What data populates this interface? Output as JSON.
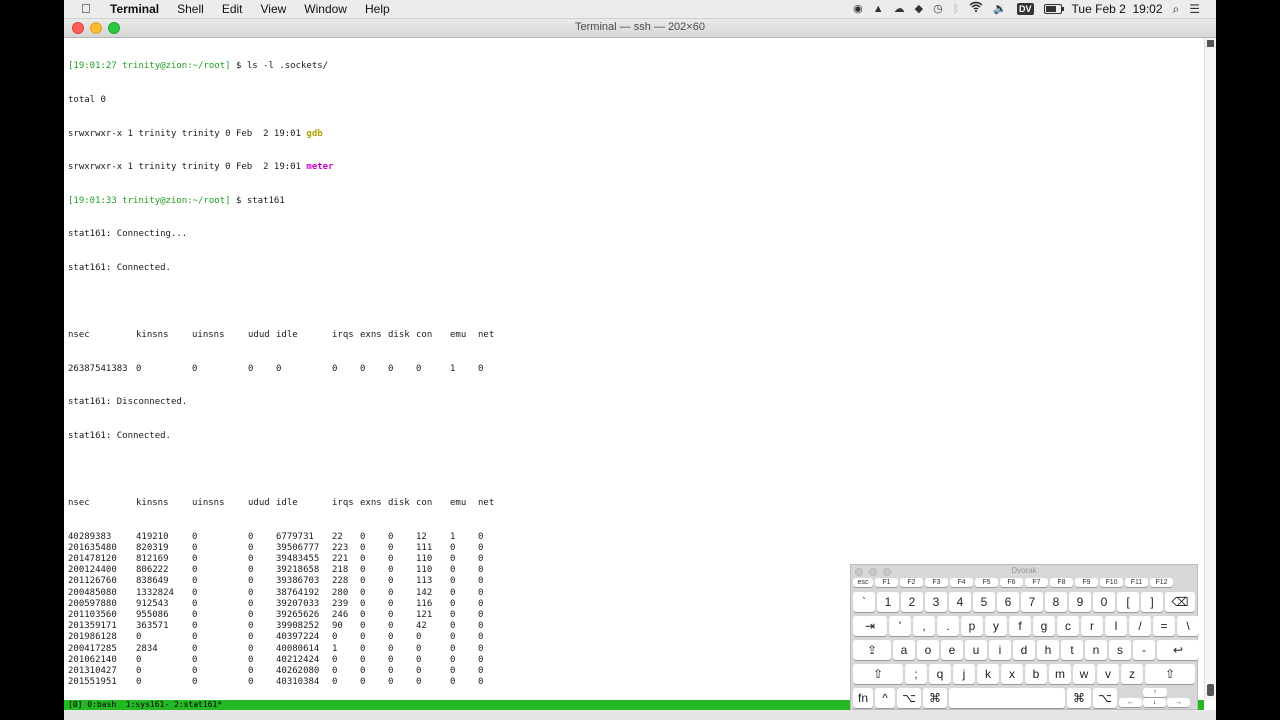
{
  "menubar": {
    "app_name": "Terminal",
    "items": [
      "Shell",
      "Edit",
      "View",
      "Window",
      "Help"
    ],
    "status_icons": [
      "record-icon",
      "drive-icon",
      "cloud-icon",
      "dropbox-icon",
      "time-machine-icon",
      "bluetooth-icon",
      "wifi-icon",
      "volume-icon"
    ],
    "input_source": "DV",
    "clock": "Tue Feb 2  19:02"
  },
  "window": {
    "title": "Terminal — ssh — 202×60"
  },
  "terminal": {
    "line1": {
      "prompt": "[19:01:27 trinity@zion:~/root]",
      "cmd": " $ ls -l .sockets/"
    },
    "line2": "total 0",
    "line3": {
      "text": "srwxrwxr-x 1 trinity trinity 0 Feb  2 19:01 ",
      "name": "gdb"
    },
    "line4": {
      "text": "srwxrwxr-x 1 trinity trinity 0 Feb  2 19:01 ",
      "name": "meter"
    },
    "line5": {
      "prompt": "[19:01:33 trinity@zion:~/root]",
      "cmd": " $ stat161"
    },
    "line6": "stat161: Connecting...",
    "line7": "stat161: Connected.",
    "headers": [
      "nsec",
      "kinsns",
      "uinsns",
      "udud",
      "idle",
      "irqs",
      "exns",
      "disk",
      "con",
      "emu",
      "net"
    ],
    "table1": [
      [
        "26387541383",
        "0",
        "0",
        "0",
        "0",
        "0",
        "0",
        "0",
        "0",
        "1",
        "0"
      ]
    ],
    "line_disc": "stat161: Disconnected.",
    "line_conn": "stat161: Connected.",
    "table2": [
      [
        "40289383",
        "419210",
        "0",
        "0",
        "6779731",
        "22",
        "0",
        "0",
        "12",
        "1",
        "0"
      ],
      [
        "201635480",
        "820319",
        "0",
        "0",
        "39506777",
        "223",
        "0",
        "0",
        "111",
        "0",
        "0"
      ],
      [
        "201478120",
        "812169",
        "0",
        "0",
        "39483455",
        "221",
        "0",
        "0",
        "110",
        "0",
        "0"
      ],
      [
        "200124400",
        "806222",
        "0",
        "0",
        "39218658",
        "218",
        "0",
        "0",
        "110",
        "0",
        "0"
      ],
      [
        "201126760",
        "838649",
        "0",
        "0",
        "39386703",
        "228",
        "0",
        "0",
        "113",
        "0",
        "0"
      ],
      [
        "200485080",
        "1332824",
        "0",
        "0",
        "38764192",
        "280",
        "0",
        "0",
        "142",
        "0",
        "0"
      ],
      [
        "200597880",
        "912543",
        "0",
        "0",
        "39207033",
        "239",
        "0",
        "0",
        "116",
        "0",
        "0"
      ],
      [
        "201103560",
        "955086",
        "0",
        "0",
        "39265626",
        "246",
        "0",
        "0",
        "121",
        "0",
        "0"
      ],
      [
        "201359171",
        "363571",
        "0",
        "0",
        "39908252",
        "90",
        "0",
        "0",
        "42",
        "0",
        "0"
      ],
      [
        "201986128",
        "0",
        "0",
        "0",
        "40397224",
        "0",
        "0",
        "0",
        "0",
        "0",
        "0"
      ],
      [
        "200417285",
        "2834",
        "0",
        "0",
        "40080614",
        "1",
        "0",
        "0",
        "0",
        "0",
        "0"
      ],
      [
        "201062140",
        "0",
        "0",
        "0",
        "40212424",
        "0",
        "0",
        "0",
        "0",
        "0",
        "0"
      ],
      [
        "201310427",
        "0",
        "0",
        "0",
        "40262080",
        "0",
        "0",
        "0",
        "0",
        "0",
        "0"
      ],
      [
        "201551951",
        "0",
        "0",
        "0",
        "40310384",
        "0",
        "0",
        "0",
        "0",
        "0",
        "0"
      ]
    ]
  },
  "tmux_status": "[0] 0:bash  1:sys161- 2:stat161*",
  "keyboard": {
    "title": "Dvorak",
    "fn_row": [
      "esc",
      "F1",
      "F2",
      "F3",
      "F4",
      "F5",
      "F6",
      "F7",
      "F8",
      "F9",
      "F10",
      "F11",
      "F12"
    ],
    "row1": [
      "`",
      "1",
      "2",
      "3",
      "4",
      "5",
      "6",
      "7",
      "8",
      "9",
      "0",
      "[",
      "]",
      "⌫"
    ],
    "row2": [
      "⇥",
      "'",
      ",",
      ".",
      "p",
      "y",
      "f",
      "g",
      "c",
      "r",
      "l",
      "/",
      "=",
      "\\"
    ],
    "row3": [
      "⇪",
      "a",
      "o",
      "e",
      "u",
      "i",
      "d",
      "h",
      "t",
      "n",
      "s",
      "-",
      "↩"
    ],
    "row4": [
      "⇧",
      ";",
      "q",
      "j",
      "k",
      "x",
      "b",
      "m",
      "w",
      "v",
      "z",
      "⇧"
    ],
    "row5": [
      "fn",
      "^",
      "⌥",
      "⌘",
      "",
      "⌘",
      "⌥"
    ],
    "arrows": [
      "↑",
      "←",
      "↓",
      "→"
    ]
  }
}
